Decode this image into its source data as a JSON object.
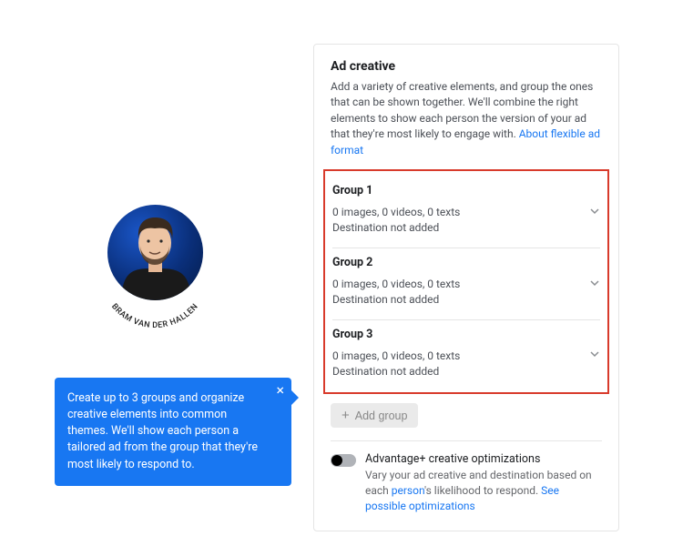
{
  "avatar": {
    "name_curved": "BRAM VAN DER HALLEN"
  },
  "tooltip": {
    "text": "Create up to 3 groups and organize creative elements into common themes. We'll show each person a tailored ad from the group that they're most likely to respond to."
  },
  "panel": {
    "title": "Ad creative",
    "description": "Add a variety of creative elements, and group the ones that can be shown together. We'll combine the right elements to show each person the version of your ad that they're most likely to engage with. ",
    "about_link": "About flexible ad format",
    "groups": [
      {
        "title": "Group 1",
        "stats": "0 images, 0 videos, 0 texts",
        "dest": "Destination not added"
      },
      {
        "title": "Group 2",
        "stats": "0 images, 0 videos, 0 texts",
        "dest": "Destination not added"
      },
      {
        "title": "Group 3",
        "stats": "0 images, 0 videos, 0 texts",
        "dest": "Destination not added"
      }
    ],
    "add_group_label": "Add group",
    "optimization": {
      "title": "Advantage+ creative optimizations",
      "sub_pre": "Vary your ad creative and destination based on each ",
      "sub_em": "person",
      "sub_post": "'s likelihood to respond. ",
      "link": "See possible optimizations"
    }
  }
}
